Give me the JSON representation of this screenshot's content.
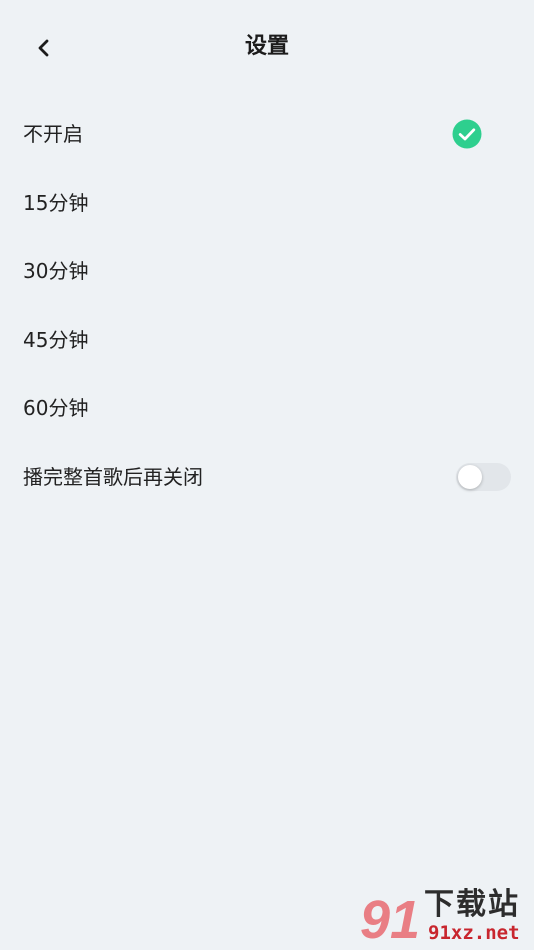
{
  "header": {
    "title": "设置"
  },
  "options": [
    {
      "label": "不开启",
      "selected": true
    },
    {
      "label": "15分钟",
      "selected": false
    },
    {
      "label": "30分钟",
      "selected": false
    },
    {
      "label": "45分钟",
      "selected": false
    },
    {
      "label": "60分钟",
      "selected": false
    }
  ],
  "finish_song_toggle": {
    "label": "播完整首歌后再关闭",
    "enabled": false
  },
  "watermark": {
    "title": "下载站",
    "url": "91xz.net",
    "logo_digits": "91"
  },
  "colors": {
    "background": "#eef2f5",
    "accent_check": "#2ecf8e",
    "toggle_track_off": "#e2e6ea",
    "watermark_red": "#c8262e"
  },
  "icons": {
    "back": "chevron-left-icon",
    "selected": "check-circle-icon"
  }
}
